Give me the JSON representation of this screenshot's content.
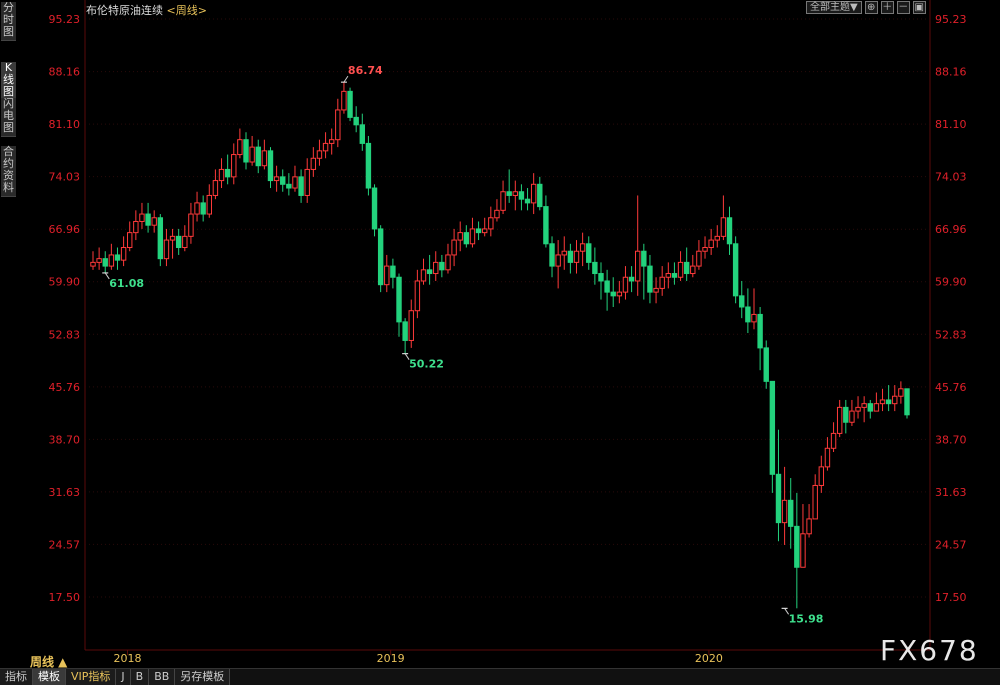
{
  "sidebar": {
    "tabs": [
      {
        "label": "分时图",
        "active": false
      },
      {
        "label": "K线图",
        "active": true
      },
      {
        "label": "闪电图",
        "active": false
      },
      {
        "label": "合约资料",
        "active": false
      }
    ]
  },
  "header": {
    "instrument": "布伦特原油连续",
    "period_tag": "<周线>",
    "theme_button": "全部主题▼",
    "icon_buttons": [
      "expand-icon",
      "zoom-in-icon",
      "zoom-out-icon",
      "reset-icon"
    ]
  },
  "footer": {
    "period_label": "周线 ▲",
    "tabs": [
      {
        "label": "指标",
        "active": false
      },
      {
        "label": "模板",
        "active": true
      },
      {
        "label": "VIP指标",
        "active": false,
        "vip": true
      },
      {
        "label": "J",
        "active": false
      },
      {
        "label": "B",
        "active": false
      },
      {
        "label": "BB",
        "active": false
      },
      {
        "label": "另存模板",
        "active": false
      }
    ]
  },
  "watermark": "FX678",
  "colors": {
    "up": "#ff3a3a",
    "down": "#23d27d",
    "axis": "#e0202a",
    "grid": "#2a0a0a"
  },
  "chart_data": {
    "type": "candlestick",
    "title": "布伦特原油连续",
    "period": "周线",
    "y_ticks": [
      95.23,
      88.16,
      81.1,
      74.03,
      66.96,
      59.9,
      52.83,
      45.76,
      38.7,
      31.63,
      24.57,
      17.5
    ],
    "ylim": [
      14.0,
      95.23
    ],
    "x_ticks": [
      "2018",
      "2019",
      "2020"
    ],
    "annotations": [
      {
        "label": "86.74",
        "kind": "high"
      },
      {
        "label": "61.08",
        "kind": "low"
      },
      {
        "label": "50.22",
        "kind": "low"
      },
      {
        "label": "15.98",
        "kind": "low"
      }
    ],
    "closes": [
      62.5,
      63.0,
      62.0,
      63.5,
      62.8,
      64.5,
      66.5,
      68.0,
      69.0,
      67.5,
      68.5,
      63.0,
      65.5,
      66.0,
      64.5,
      66.0,
      69.0,
      70.5,
      69.0,
      71.5,
      73.5,
      75.0,
      74.0,
      77.0,
      79.0,
      76.0,
      78.0,
      75.5,
      77.5,
      73.5,
      74.0,
      73.0,
      72.5,
      74.0,
      71.5,
      75.0,
      76.5,
      77.5,
      78.5,
      79.0,
      83.0,
      85.5,
      82.0,
      81.0,
      78.5,
      72.5,
      67.0,
      59.5,
      62.0,
      60.5,
      54.5,
      52.0,
      56.0,
      60.0,
      61.5,
      61.0,
      62.5,
      61.5,
      63.5,
      65.5,
      66.5,
      65.0,
      67.0,
      66.5,
      67.0,
      68.5,
      69.5,
      72.0,
      71.5,
      72.0,
      71.0,
      70.5,
      73.0,
      70.0,
      65.0,
      62.0,
      63.5,
      64.0,
      62.5,
      64.0,
      65.0,
      62.5,
      61.0,
      60.0,
      58.5,
      58.0,
      58.5,
      60.5,
      60.0,
      64.0,
      62.0,
      58.5,
      59.0,
      60.5,
      61.0,
      60.5,
      62.5,
      61.0,
      62.0,
      64.0,
      64.5,
      65.5,
      66.0,
      68.5,
      65.0,
      58.0,
      56.5,
      54.5,
      55.5,
      51.0,
      46.5,
      34.0,
      27.5,
      30.5,
      27.0,
      21.5,
      26.0,
      28.0,
      32.5,
      35.0,
      37.5,
      39.5,
      43.0,
      41.0,
      42.5,
      43.0,
      43.5,
      42.5,
      43.5,
      44.0,
      43.5,
      44.5,
      45.5,
      42.0
    ],
    "highs": [
      64.0,
      64.5,
      64.0,
      65.0,
      64.5,
      66.0,
      68.0,
      69.5,
      70.5,
      70.5,
      69.5,
      69.0,
      67.0,
      67.0,
      67.0,
      67.5,
      70.5,
      72.0,
      71.5,
      73.0,
      75.0,
      76.5,
      77.0,
      78.5,
      80.5,
      80.0,
      79.5,
      79.0,
      79.0,
      78.0,
      75.5,
      75.0,
      74.5,
      75.5,
      75.0,
      76.5,
      78.0,
      79.0,
      80.0,
      80.5,
      84.5,
      86.74,
      86.0,
      83.5,
      82.5,
      79.5,
      73.0,
      67.5,
      63.5,
      63.0,
      61.0,
      55.0,
      57.5,
      61.5,
      63.0,
      63.5,
      64.0,
      63.5,
      65.0,
      67.0,
      68.0,
      67.5,
      68.5,
      68.0,
      68.5,
      70.0,
      71.0,
      73.5,
      75.0,
      73.5,
      73.0,
      72.5,
      74.5,
      74.0,
      71.5,
      66.0,
      65.5,
      66.0,
      65.0,
      65.5,
      66.5,
      66.0,
      64.5,
      62.5,
      61.5,
      60.5,
      60.0,
      62.0,
      62.0,
      71.5,
      65.0,
      63.5,
      60.5,
      62.0,
      62.5,
      62.5,
      64.0,
      64.5,
      63.5,
      65.5,
      66.0,
      67.0,
      67.5,
      71.5,
      70.0,
      66.0,
      60.0,
      59.0,
      59.0,
      56.5,
      52.0,
      46.0,
      40.0,
      35.0,
      33.5,
      31.5,
      30.0,
      30.0,
      34.0,
      36.5,
      39.0,
      41.0,
      44.0,
      44.0,
      44.0,
      44.5,
      44.5,
      44.0,
      45.0,
      45.5,
      46.0,
      46.0,
      46.5,
      45.5
    ],
    "lows": [
      61.5,
      61.5,
      61.08,
      61.5,
      61.5,
      62.0,
      64.0,
      65.5,
      67.0,
      66.5,
      66.5,
      62.0,
      62.0,
      63.0,
      63.5,
      64.0,
      65.0,
      68.0,
      68.0,
      68.5,
      71.0,
      72.5,
      73.0,
      73.0,
      76.5,
      75.0,
      75.5,
      74.5,
      75.0,
      72.5,
      72.0,
      72.0,
      71.5,
      72.0,
      70.5,
      70.5,
      74.0,
      75.5,
      76.5,
      77.0,
      78.0,
      82.5,
      81.5,
      80.0,
      77.5,
      71.5,
      66.0,
      58.5,
      58.5,
      59.0,
      52.5,
      50.22,
      51.0,
      55.0,
      59.5,
      59.5,
      60.0,
      60.5,
      61.0,
      62.0,
      64.0,
      64.5,
      64.5,
      65.5,
      66.0,
      66.0,
      68.0,
      69.0,
      70.5,
      69.5,
      69.5,
      69.5,
      69.0,
      69.5,
      64.5,
      60.5,
      59.0,
      61.5,
      61.0,
      61.0,
      62.0,
      61.5,
      59.5,
      57.5,
      56.0,
      56.5,
      57.0,
      57.5,
      58.5,
      58.0,
      57.5,
      57.0,
      57.0,
      58.0,
      59.0,
      59.5,
      60.0,
      60.0,
      60.5,
      61.5,
      63.0,
      63.5,
      64.5,
      65.5,
      63.5,
      57.0,
      55.0,
      53.0,
      53.5,
      48.0,
      45.5,
      31.5,
      25.0,
      24.5,
      24.0,
      15.98,
      21.5,
      25.5,
      28.0,
      31.5,
      34.5,
      37.0,
      39.0,
      39.5,
      40.5,
      41.5,
      41.0,
      41.5,
      42.5,
      42.5,
      42.5,
      42.5,
      43.5,
      41.5
    ]
  }
}
